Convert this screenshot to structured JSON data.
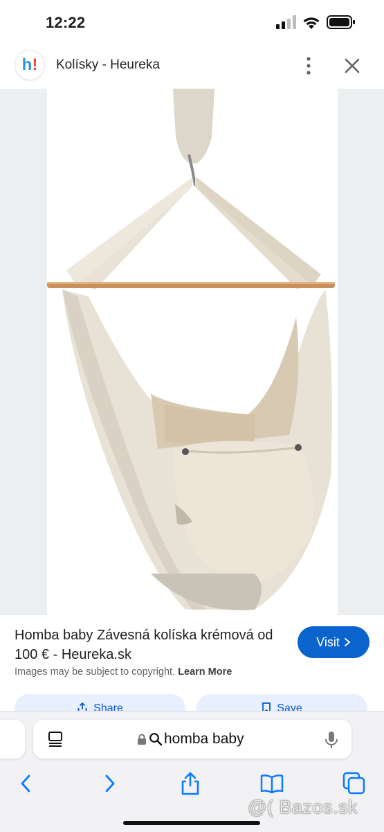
{
  "status_bar": {
    "time": "12:22"
  },
  "header": {
    "site_badge_h": "h",
    "site_badge_mark": "!",
    "title": "Kolísky - Heureka"
  },
  "result": {
    "title": "Homba baby Závesná kolíska krémová od 100 € - Heureka.sk",
    "visit_label": "Visit",
    "copyright_text": "Images may be subject to copyright.",
    "learn_more": "Learn More",
    "share_label": "Share",
    "save_label": "Save"
  },
  "browser": {
    "query": "homba baby"
  },
  "watermark": "@( Bazos.sk",
  "colors": {
    "accent": "#0b63ce",
    "sheet_bg": "#eceeef",
    "toolbar_bg": "#f2f2f4",
    "tint_blue": "#0a7aff"
  },
  "icons": [
    "signal-icon",
    "wifi-icon",
    "battery-icon",
    "more-vertical-icon",
    "close-icon",
    "lens-icon",
    "chevron-right-icon",
    "share-icon",
    "bookmark-icon",
    "tabs-icon",
    "lock-icon",
    "search-icon",
    "mic-icon",
    "back-icon",
    "forward-icon",
    "book-icon",
    "tab-overview-icon"
  ]
}
